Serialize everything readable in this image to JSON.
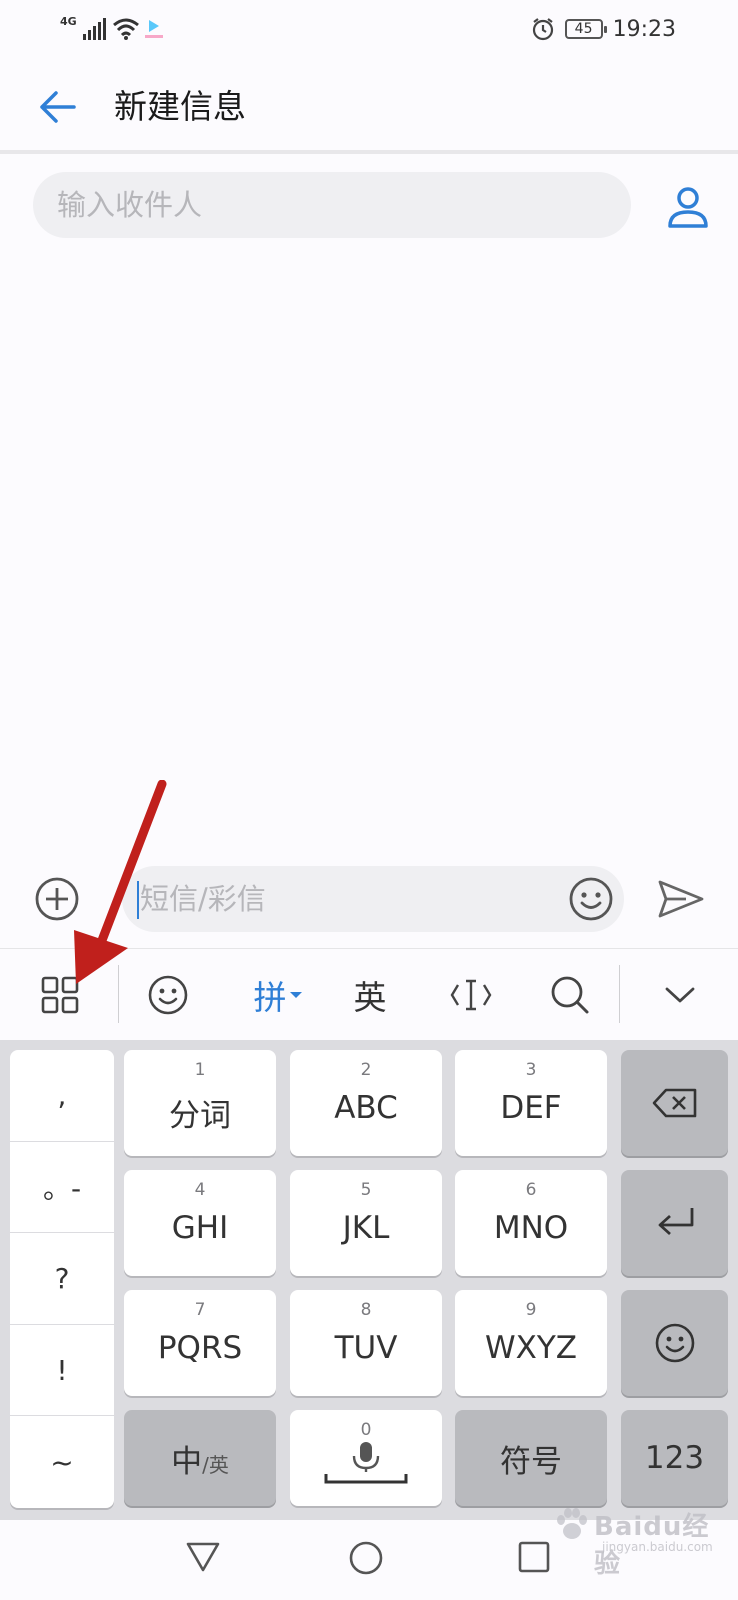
{
  "status_bar": {
    "network": "4G",
    "battery": "45",
    "time": "19:23",
    "icons": [
      "signal-icon",
      "wifi-icon",
      "app-badge-icon",
      "alarm-icon",
      "battery-icon"
    ]
  },
  "header": {
    "title": "新建信息",
    "back_icon": "arrow-left-icon"
  },
  "recipient": {
    "placeholder": "输入收件人",
    "value": "",
    "contact_icon": "person-icon"
  },
  "compose": {
    "placeholder": "短信/彩信",
    "add_icon": "plus-circle-icon",
    "emoji_icon": "smiley-icon",
    "send_icon": "send-icon"
  },
  "keyboard_toolbar": {
    "pinyin_label": "拼",
    "english_label": "英",
    "items": [
      "grid-menu-icon",
      "emoji-icon",
      "pinyin",
      "english",
      "cursor-icon",
      "search-icon",
      "collapse-icon"
    ]
  },
  "keyboard": {
    "punctuation": [
      ",",
      "。-",
      "?",
      "!",
      "~"
    ],
    "keys": [
      {
        "num": "1",
        "label": "分词"
      },
      {
        "num": "2",
        "label": "ABC"
      },
      {
        "num": "3",
        "label": "DEF"
      },
      {
        "num": "4",
        "label": "GHI"
      },
      {
        "num": "5",
        "label": "JKL"
      },
      {
        "num": "6",
        "label": "MNO"
      },
      {
        "num": "7",
        "label": "PQRS"
      },
      {
        "num": "8",
        "label": "TUV"
      },
      {
        "num": "9",
        "label": "WXYZ"
      }
    ],
    "space_num": "0",
    "lang_switch_main": "中",
    "lang_switch_sub": "/英",
    "symbols_label": "符号",
    "numbers_label": "123"
  },
  "watermark": {
    "text": "Baidu经验",
    "sub": "jingyan.baidu.com"
  },
  "colors": {
    "accent": "#2f7fd6",
    "arrow": "#c0201c",
    "key_gray": "#b9babe"
  }
}
